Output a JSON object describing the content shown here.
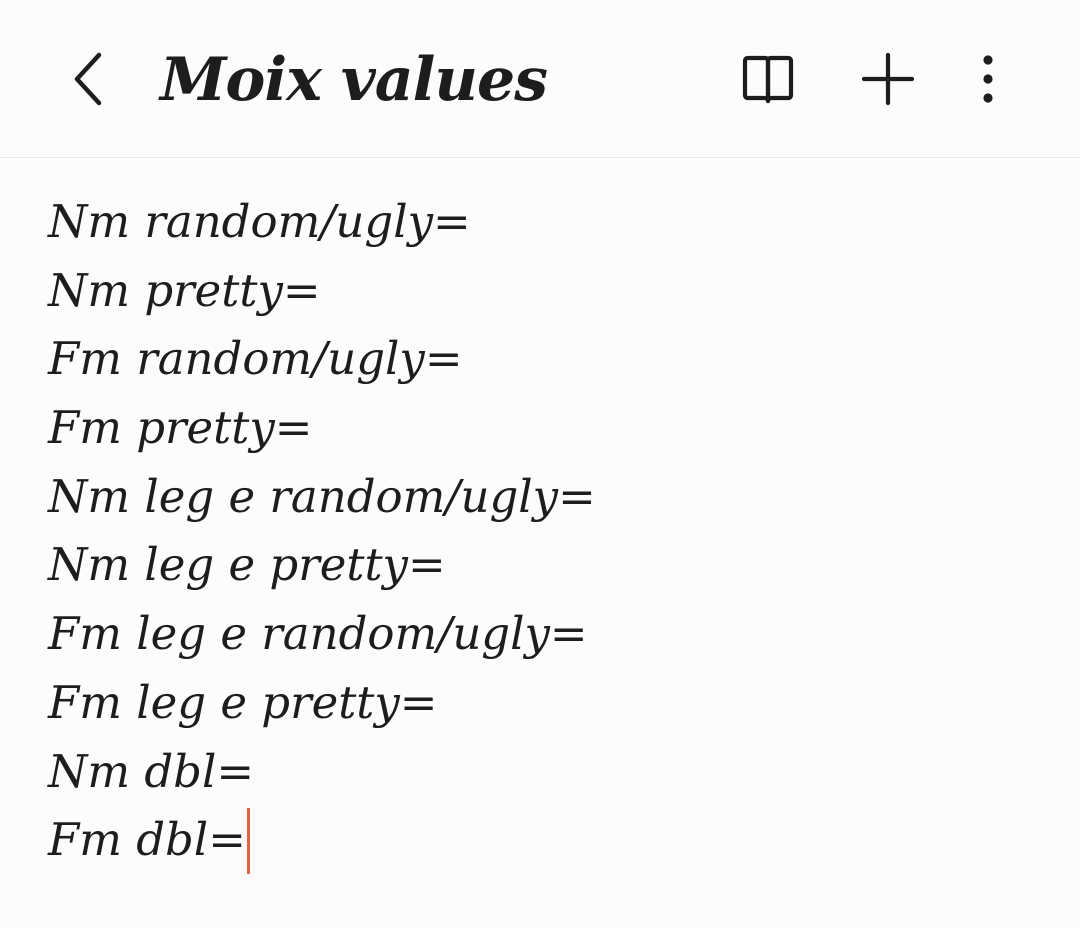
{
  "header": {
    "title": "Moix values",
    "icons": {
      "back": "chevron-left-icon",
      "reading_mode": "open-book-icon",
      "add": "plus-icon",
      "more": "more-vertical-icon"
    }
  },
  "note": {
    "lines": [
      "Nm random/ugly=",
      "Nm pretty=",
      "Fm random/ugly=",
      "Fm pretty=",
      "Nm leg e random/ugly=",
      "Nm leg e pretty=",
      "Fm leg e random/ugly=",
      "Fm leg e pretty=",
      "Nm dbl=",
      "Fm dbl="
    ]
  },
  "colors": {
    "background": "#fcfcfc",
    "text": "#1d1d1f",
    "caret": "#e0653a",
    "divider": "#e9e9e9"
  }
}
